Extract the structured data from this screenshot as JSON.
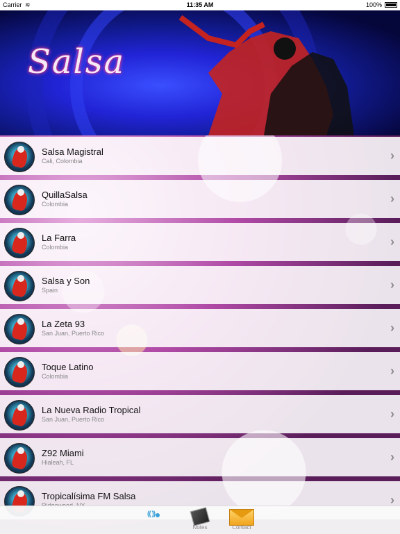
{
  "status_bar": {
    "carrier": "Carrier",
    "time": "11:35 AM",
    "battery": "100%"
  },
  "banner": {
    "title": "Salsa"
  },
  "stations": [
    {
      "name": "Salsa Magistral",
      "location": "Cali, Colombia"
    },
    {
      "name": "QuillaSalsa",
      "location": "Colombia"
    },
    {
      "name": "La Farra",
      "location": "Colombia"
    },
    {
      "name": "Salsa y Son",
      "location": "Spain"
    },
    {
      "name": "La Zeta 93",
      "location": "San Juan, Puerto Rico"
    },
    {
      "name": "Toque Latino",
      "location": "Colombia"
    },
    {
      "name": "La Nueva Radio Tropical",
      "location": "San Juan, Puerto Rico"
    },
    {
      "name": "Z92 Miami",
      "location": "Hialeah, FL"
    },
    {
      "name": "Tropicalísima FM Salsa",
      "location": "Ridgewood, NY"
    }
  ],
  "tabs": [
    {
      "label": "",
      "icon": "radio-wifi-icon",
      "color": "#3aa0d8"
    },
    {
      "label": "Notes",
      "icon": "notes-icon"
    },
    {
      "label": "Contact",
      "icon": "mail-icon"
    }
  ]
}
